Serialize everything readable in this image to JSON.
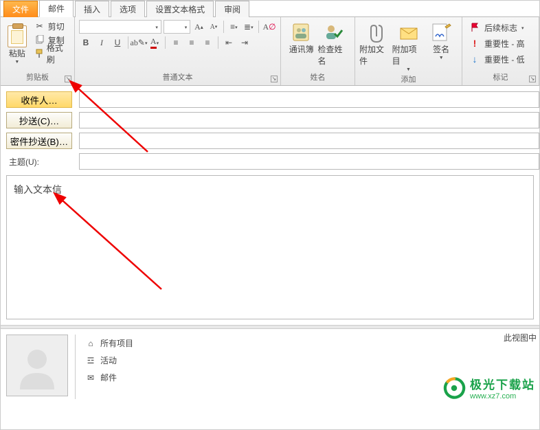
{
  "tabs": {
    "file": "文件",
    "mail": "邮件",
    "insert": "插入",
    "options": "选项",
    "format": "设置文本格式",
    "review": "审阅"
  },
  "clipboard": {
    "paste": "粘贴",
    "cut": "剪切",
    "copy": "复制",
    "fmtpainter": "格式刷",
    "label": "剪贴板"
  },
  "font": {
    "label": "普通文本",
    "b": "B",
    "i": "I",
    "u": "U"
  },
  "names": {
    "book": "通讯簿",
    "check": "检查姓名",
    "label": "姓名"
  },
  "attach": {
    "file": "附加文件",
    "item": "附加项目",
    "sign": "签名",
    "label": "添加"
  },
  "tags": {
    "followup": "后续标志",
    "high": "重要性 - 高",
    "low": "重要性 - 低",
    "label": "标记"
  },
  "recip": {
    "to": "收件人…",
    "cc": "抄送(C)…",
    "bcc": "密件抄送(B)…",
    "subject": "主题(U):"
  },
  "body_text": "输入文本信",
  "bottom": {
    "all": "所有项目",
    "activity": "活动",
    "mail": "邮件",
    "caption": "此视图中"
  },
  "watermark": {
    "title": "极光下载站",
    "url": "www.xz7.com"
  }
}
